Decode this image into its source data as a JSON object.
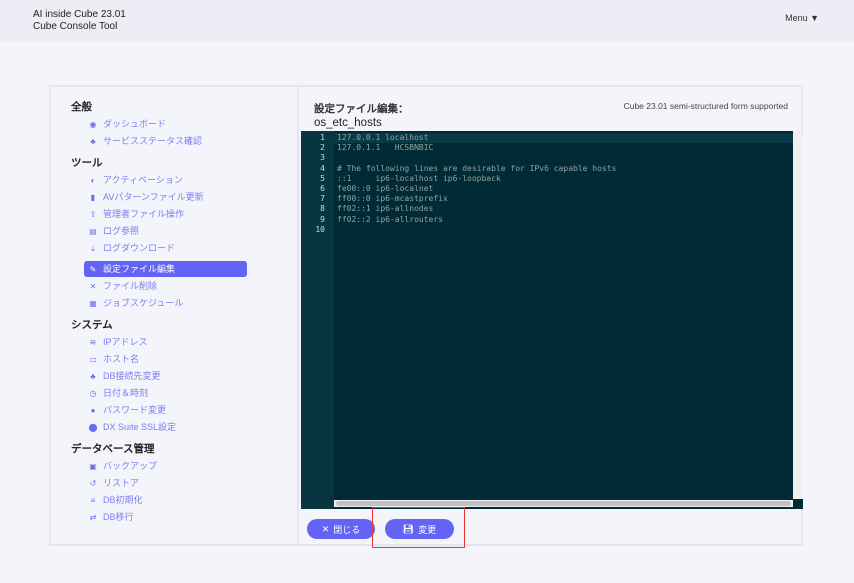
{
  "header": {
    "app_title": "AI inside Cube 23.01",
    "app_subtitle": "Cube Console Tool",
    "menu_label": "Menu ▼"
  },
  "sidebar": {
    "sections": [
      {
        "heading": "全般",
        "items": [
          {
            "label": "ダッシュボード",
            "icon": "dashboard-icon"
          },
          {
            "label": "サービスステータス確認",
            "icon": "cubes-icon"
          }
        ]
      },
      {
        "heading": "ツール",
        "items": [
          {
            "label": "アクティベーション",
            "icon": "shield-icon"
          },
          {
            "label": "AVパターンファイル更新",
            "icon": "file-icon"
          },
          {
            "label": "管理者ファイル操作",
            "icon": "upload-icon"
          },
          {
            "label": "ログ参照",
            "icon": "file-text-icon"
          },
          {
            "label": "ログダウンロード",
            "icon": "download-icon"
          },
          {
            "label": "設定ファイル編集",
            "icon": "edit-icon",
            "active": true
          },
          {
            "label": "ファイル削除",
            "icon": "close-icon"
          },
          {
            "label": "ジョブスケジュール",
            "icon": "calendar-icon"
          }
        ]
      },
      {
        "heading": "システム",
        "items": [
          {
            "label": "IPアドレス",
            "icon": "rss-icon"
          },
          {
            "label": "ホスト名",
            "icon": "monitor-icon"
          },
          {
            "label": "DB接続先変更",
            "icon": "cubes-icon"
          },
          {
            "label": "日付＆時刻",
            "icon": "clock-icon"
          },
          {
            "label": "パスワード変更",
            "icon": "user-icon"
          },
          {
            "label": "DX Suite SSL設定",
            "icon": "circle-icon"
          }
        ]
      },
      {
        "heading": "データベース管理",
        "items": [
          {
            "label": "バックアップ",
            "icon": "save-icon"
          },
          {
            "label": "リストア",
            "icon": "undo-icon"
          },
          {
            "label": "DB初期化",
            "icon": "database-icon"
          },
          {
            "label": "DB移行",
            "icon": "exchange-icon"
          }
        ]
      }
    ]
  },
  "editor": {
    "title": "設定ファイル編集：",
    "filename": "os_etc_hosts",
    "support_note": "Cube 23.01 semi-structured form supported",
    "lines": [
      "127.0.0.1 localhost",
      "127.0.1.1\tHCSBNBIC",
      "",
      "# The following lines are desirable for IPv6 capable hosts",
      "::1     ip6-localhost ip6-loopback",
      "fe00::0 ip6-localnet",
      "ff00::0 ip6-mcastprefix",
      "ff02::1 ip6-allnodes",
      "ff02::2 ip6-allrouters",
      ""
    ]
  },
  "buttons": {
    "close_label": "閉じる",
    "save_label": "変更"
  },
  "colors": {
    "accent": "#6363f5",
    "editor_bg": "#002b36"
  }
}
